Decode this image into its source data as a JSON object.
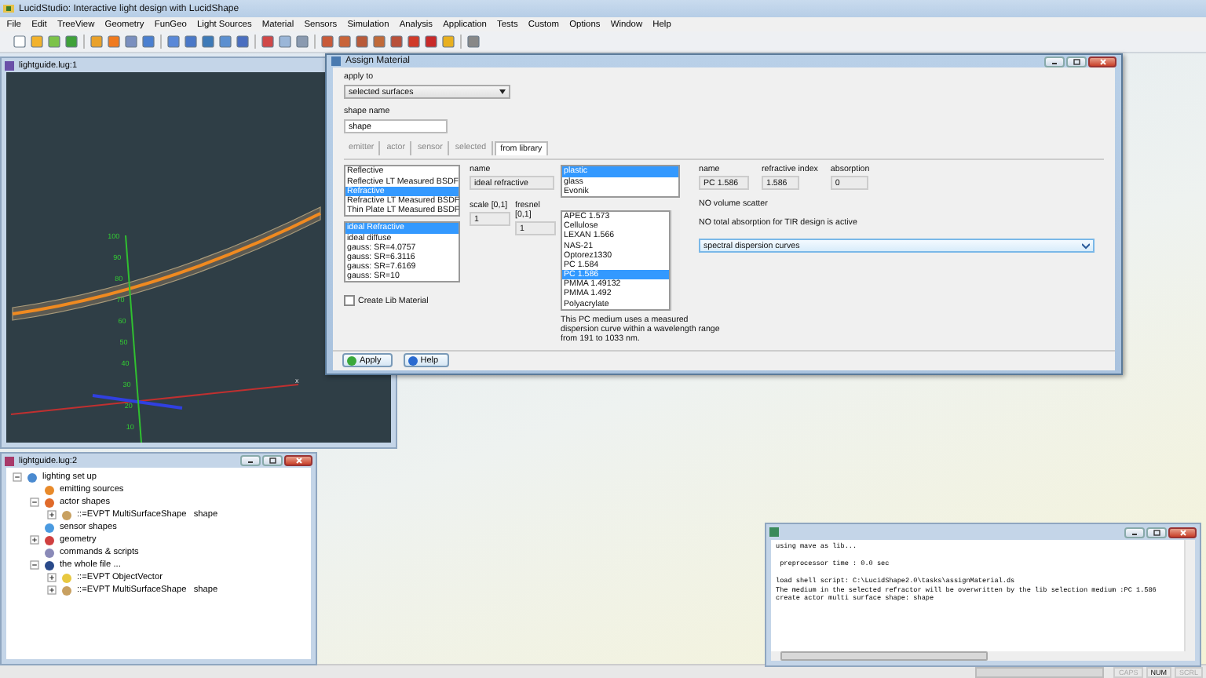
{
  "app": {
    "title": "LucidStudio: Interactive light design with LucidShape"
  },
  "menu": [
    "File",
    "Edit",
    "TreeView",
    "Geometry",
    "FunGeo",
    "Light Sources",
    "Material",
    "Sensors",
    "Simulation",
    "Analysis",
    "Application",
    "Tests",
    "Custom",
    "Options",
    "Window",
    "Help"
  ],
  "viewport_window": {
    "title": "lightguide.lug:1",
    "y_ticks": [
      "100",
      "90",
      "80",
      "70",
      "60",
      "50",
      "40",
      "30",
      "20",
      "10"
    ],
    "x_axis_label": "x"
  },
  "dialog": {
    "title": "Assign Material",
    "apply_to": {
      "label": "apply to",
      "value": "selected surfaces"
    },
    "shape_name": {
      "label": "shape name",
      "value": "shape"
    },
    "tabs": [
      {
        "label": "emitter",
        "selected": false
      },
      {
        "label": "actor",
        "selected": false
      },
      {
        "label": "sensor",
        "selected": false
      },
      {
        "label": "selected",
        "selected": false
      },
      {
        "label": "from library",
        "selected": true
      }
    ],
    "surface_types": [
      {
        "label": "Reflective",
        "selected": false
      },
      {
        "label": "Reflective LT Measured BSDF",
        "selected": false
      },
      {
        "label": "Refractive",
        "selected": true
      },
      {
        "label": "Refractive LT Measured BSDF",
        "selected": false
      },
      {
        "label": "Thin Plate LT Measured BSDF",
        "selected": false
      }
    ],
    "surface_models": [
      {
        "label": "ideal Refractive",
        "selected": true
      },
      {
        "label": "ideal diffuse",
        "selected": false
      },
      {
        "label": "gauss: SR=4.0757",
        "selected": false
      },
      {
        "label": "gauss: SR=6.3116",
        "selected": false
      },
      {
        "label": "gauss: SR=7.6169",
        "selected": false
      },
      {
        "label": "gauss: SR=10",
        "selected": false
      }
    ],
    "create_lib_material": {
      "label": "Create Lib Material",
      "checked": false
    },
    "model": {
      "name_label": "name",
      "name": "ideal refractive",
      "scale_label": "scale [0,1]",
      "scale": "1",
      "fresnel_label": "fresnel [0,1]",
      "fresnel": "1"
    },
    "material_groups": [
      {
        "label": "plastic",
        "selected": true
      },
      {
        "label": "glass",
        "selected": false
      },
      {
        "label": "Evonik",
        "selected": false
      }
    ],
    "materials": [
      {
        "label": "APEC 1.573",
        "selected": false
      },
      {
        "label": "Cellulose",
        "selected": false
      },
      {
        "label": "LEXAN 1.566",
        "selected": false
      },
      {
        "label": "NAS-21",
        "selected": false
      },
      {
        "label": "Optorez1330",
        "selected": false
      },
      {
        "label": "PC 1.584",
        "selected": false
      },
      {
        "label": "PC 1.586",
        "selected": true
      },
      {
        "label": "PMMA 1.49132",
        "selected": false
      },
      {
        "label": "PMMA 1.492",
        "selected": false
      },
      {
        "label": "Polyacrylate",
        "selected": false
      }
    ],
    "material_description": "This PC medium uses a measured dispersion curve within a wavelength range from 191 to 1033 nm.",
    "medium": {
      "name_label": "name",
      "name": "PC 1.586",
      "index_label": "refractive index",
      "index": "1.586",
      "absorption_label": "absorption",
      "absorption": "0"
    },
    "notes": [
      "NO volume scatter",
      "NO total absorption for TIR design is active"
    ],
    "dispersion": {
      "value": "spectral dispersion curves"
    },
    "buttons": [
      {
        "label": "Apply",
        "kind": "apply"
      },
      {
        "label": "Help",
        "kind": "help"
      }
    ]
  },
  "tree_window": {
    "title": "lightguide.lug:2",
    "nodes": [
      {
        "label": "lighting set up",
        "expanded": true,
        "children": [
          {
            "label": "emitting sources"
          },
          {
            "label": "actor shapes",
            "expanded": true,
            "children": [
              {
                "label": "::=EVPT MultiSurfaceShape   shape",
                "expanded": false
              }
            ]
          },
          {
            "label": "sensor shapes"
          },
          {
            "label": "geometry",
            "expanded": false
          },
          {
            "label": "commands & scripts"
          },
          {
            "label": "the whole file ...",
            "expanded": true,
            "children": [
              {
                "label": "::=EVPT ObjectVector",
                "expanded": false
              },
              {
                "label": "::=EVPT MultiSurfaceShape   shape",
                "expanded": false
              }
            ]
          }
        ]
      }
    ]
  },
  "console": {
    "blocks": [
      [
        "using mave as lib..."
      ],
      [
        " preprocessor time : 0.0 sec"
      ],
      [
        "load shell script: C:\\LucidShape2.0\\tasks\\assignMaterial.ds",
        "The medium in the selected refractor will be overwritten by the lib selection medium :PC 1.586",
        "create actor multi surface shape: shape"
      ]
    ]
  },
  "status_bar": {
    "indicators": [
      {
        "label": "CAPS",
        "on": false
      },
      {
        "label": "NUM",
        "on": true
      },
      {
        "label": "SCRL",
        "on": false
      }
    ]
  }
}
